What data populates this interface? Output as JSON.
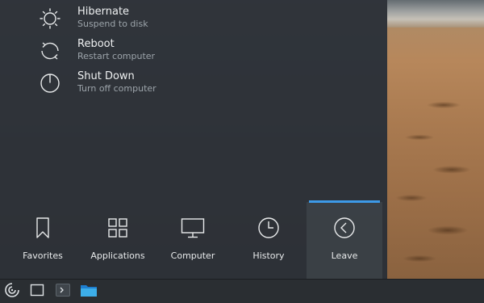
{
  "leave_menu": {
    "items": [
      {
        "title": "Hibernate",
        "subtitle": "Suspend to disk",
        "icon": "hibernate-icon"
      },
      {
        "title": "Reboot",
        "subtitle": "Restart computer",
        "icon": "reboot-icon"
      },
      {
        "title": "Shut Down",
        "subtitle": "Turn off computer",
        "icon": "power-icon"
      }
    ]
  },
  "tabs": [
    {
      "label": "Favorites",
      "icon": "bookmark-icon"
    },
    {
      "label": "Applications",
      "icon": "grid-icon"
    },
    {
      "label": "Computer",
      "icon": "monitor-icon"
    },
    {
      "label": "History",
      "icon": "clock-icon"
    },
    {
      "label": "Leave",
      "icon": "back-arrow-icon",
      "active": true
    }
  ],
  "taskbar": {
    "items": [
      "launcher-icon",
      "show-desktop-icon",
      "terminal-icon",
      "file-manager-icon"
    ]
  },
  "colors": {
    "accent": "#3d9ae8",
    "panel": "#2c3035",
    "text": "#eef0f1",
    "subtext": "#9ca4aa"
  }
}
